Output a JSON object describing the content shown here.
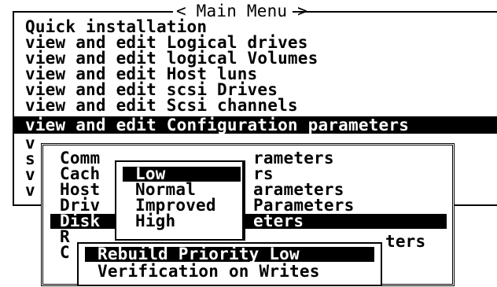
{
  "main_menu": {
    "title": "< Main Menu >",
    "items": [
      "Quick installation",
      "view and edit Logical drives",
      "view and edit logical Volumes",
      "view and edit Host luns",
      "view and edit scsi Drives",
      "view and edit Scsi channels",
      "view and edit Configuration parameters"
    ],
    "hidden_item_starts": [
      "v",
      "s",
      "v",
      "v"
    ]
  },
  "config_submenu": {
    "items": [
      {
        "left": "Comm",
        "right": "rameters"
      },
      {
        "left": "Cach",
        "right": "rs"
      },
      {
        "left": "Host",
        "right": "arameters"
      },
      {
        "left": "Driv",
        "right": "Parameters"
      },
      {
        "left": "Disk",
        "right": "eters"
      },
      {
        "left": "R",
        "right": "ters"
      },
      {
        "left": "C",
        "right": ""
      }
    ]
  },
  "priority_popup": {
    "options": [
      "Low",
      "Normal",
      "Improved",
      "High"
    ],
    "selected": "Low"
  },
  "disk_array_panel": {
    "items": [
      "Rebuild Priority Low",
      "Verification on Writes"
    ]
  }
}
